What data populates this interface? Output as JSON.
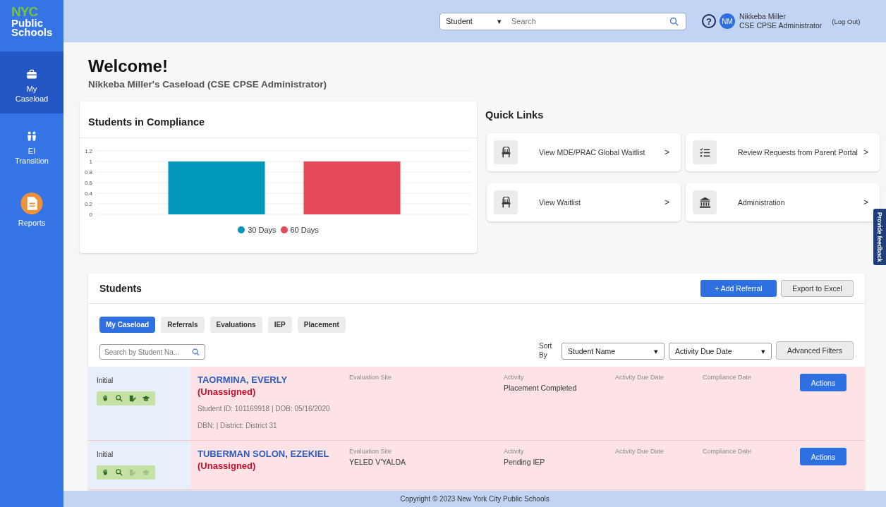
{
  "sidebar": {
    "logo": {
      "mark": "NYC",
      "line1": "Public",
      "line2": "Schools"
    },
    "items": [
      {
        "kind": "briefcase",
        "label": "My Caseload",
        "selected": true
      },
      {
        "kind": "people",
        "label": "EI Transition",
        "selected": false
      },
      {
        "kind": "document",
        "label": "Reports",
        "selected": false
      }
    ]
  },
  "topbar": {
    "search_scope": "Student",
    "scope_caret": "▾",
    "search": {
      "placeholder": "Search"
    },
    "help": "?",
    "avatar": "NM",
    "user_name": "Nikkeba Miller",
    "user_role": "CSE CPSE Administrator",
    "logout": "(Log Out)"
  },
  "welcome": {
    "title": "Welcome!",
    "subtitle": "Nikkeba Miller's Caseload (CSE CPSE Administrator)"
  },
  "compliance": {
    "title": "Students in Compliance",
    "chart_data": {
      "type": "bar",
      "grid": true,
      "legend": true,
      "ylim": [
        0,
        1.2
      ],
      "yticks": [
        0,
        0.2,
        0.4,
        0.6,
        0.8,
        1,
        1.2
      ],
      "series": [
        {
          "name": "30 Days",
          "color": "#0097b9",
          "values": [
            1
          ]
        },
        {
          "name": "60 Days",
          "color": "#e34957",
          "values": [
            1
          ]
        }
      ]
    }
  },
  "quick_links": {
    "title": "Quick Links",
    "items": [
      {
        "kind": "chair",
        "label": "View MDE/PRAC Global Waitlist",
        "arrow": ">"
      },
      {
        "kind": "checklist",
        "label": "Review Requests from Parent Portal",
        "arrow": ">"
      },
      {
        "kind": "chair",
        "label": "View Waitlist",
        "arrow": ">"
      },
      {
        "kind": "bank",
        "label": "Administration",
        "arrow": ">"
      }
    ]
  },
  "feedback_tab": "Provide feedback",
  "students": {
    "title": "Students",
    "add_button": "+ Add Referral",
    "export_button": "Export to Excel",
    "tabs": [
      {
        "label": "My Caseload",
        "selected": true
      },
      {
        "label": "Referrals",
        "selected": false
      },
      {
        "label": "Evaluations",
        "selected": false
      },
      {
        "label": "IEP",
        "selected": false
      },
      {
        "label": "Placement",
        "selected": false
      }
    ],
    "search": {
      "placeholder": "Search by Student Na..."
    },
    "sort_label": "Sort By",
    "sort_field": "Student Name",
    "sort_field_caret": "▾",
    "sort_date": "Activity Due Date",
    "sort_date_caret": "▾",
    "advanced_filters": "Advanced Filters",
    "rows": [
      {
        "type": "Initial",
        "tools": [
          {
            "kind": "hand",
            "enabled": true
          },
          {
            "kind": "search",
            "enabled": true
          },
          {
            "kind": "edit",
            "enabled": true
          },
          {
            "kind": "cap",
            "enabled": true
          }
        ],
        "name": "TAORMINA, EVERLY",
        "assignee": "(Unassigned)",
        "student_line": "Student ID: 101169918 | DOB: 05/16/2020",
        "dbn_line": "DBN: | District: District 31",
        "evaluation_site_label": "Evaluation Site",
        "activity_label": "Activity",
        "activity": "Placement Completed",
        "activity_due_label": "Activity Due Date",
        "compliance_label": "Compliance Date",
        "action": "Actions"
      },
      {
        "type": "Initial",
        "tools": [
          {
            "kind": "hand",
            "enabled": true
          },
          {
            "kind": "search",
            "enabled": true
          },
          {
            "kind": "edit",
            "enabled": false
          },
          {
            "kind": "cap",
            "enabled": false
          }
        ],
        "name": "TUBERMAN SOLON, EZEKIEL",
        "assignee": "(Unassigned)",
        "evaluation_site_label": "Evaluation Site",
        "evaluation_site": "YELED V'YALDA",
        "activity_label": "Activity",
        "activity": "Pending IEP",
        "activity_due_label": "Activity Due Date",
        "compliance_label": "Compliance Date",
        "action": "Actions"
      }
    ]
  },
  "footer": "Copyright © 2023 New York City Public Schools"
}
